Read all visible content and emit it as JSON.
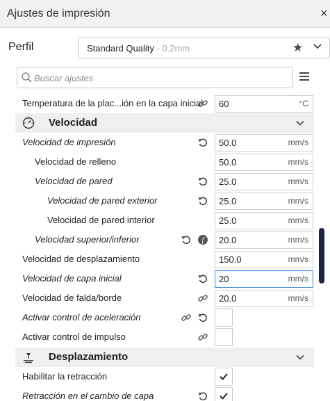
{
  "window": {
    "title": "Ajustes de impresión",
    "close_label": "×"
  },
  "profile": {
    "label": "Perfil",
    "name": "Standard Quality",
    "layer": "- 0.2mm"
  },
  "search": {
    "placeholder": "Buscar ajustes"
  },
  "settings": {
    "temp_initial": {
      "label": "Temperatura de la plac...ión en la capa inicial",
      "value": "60",
      "unit": "°C"
    },
    "velocidad": {
      "title": "Velocidad"
    },
    "print_speed": {
      "label": "Velocidad de impresión",
      "value": "50.0",
      "unit": "mm/s"
    },
    "infill_speed": {
      "label": "Velocidad de relleno",
      "value": "50.0",
      "unit": "mm/s"
    },
    "wall_speed": {
      "label": "Velocidad de pared",
      "value": "25.0",
      "unit": "mm/s"
    },
    "outer_wall_speed": {
      "label": "Velocidad de pared exterior",
      "value": "25.0",
      "unit": "mm/s"
    },
    "inner_wall_speed": {
      "label": "Velocidad de pared interior",
      "value": "25.0",
      "unit": "mm/s"
    },
    "topbottom_speed": {
      "label": "Velocidad superior/inferior",
      "value": "20.0",
      "unit": "mm/s"
    },
    "travel_speed": {
      "label": "Velocidad de desplazamiento",
      "value": "150.0",
      "unit": "mm/s"
    },
    "initial_layer_speed": {
      "label": "Velocidad de capa inicial",
      "value": "20",
      "unit": "mm/s"
    },
    "skirt_speed": {
      "label": "Velocidad de falda/borde",
      "value": "20.0",
      "unit": "mm/s"
    },
    "accel_control": {
      "label": "Activar control de aceleración",
      "checked": false
    },
    "jerk_control": {
      "label": "Activar control de impulso",
      "checked": false
    },
    "desplazamiento": {
      "title": "Desplazamiento"
    },
    "retraction": {
      "label": "Habilitar la retracción",
      "checked": true
    },
    "retract_layer_change": {
      "label": "Retracción en el cambio de capa",
      "checked": true
    }
  }
}
